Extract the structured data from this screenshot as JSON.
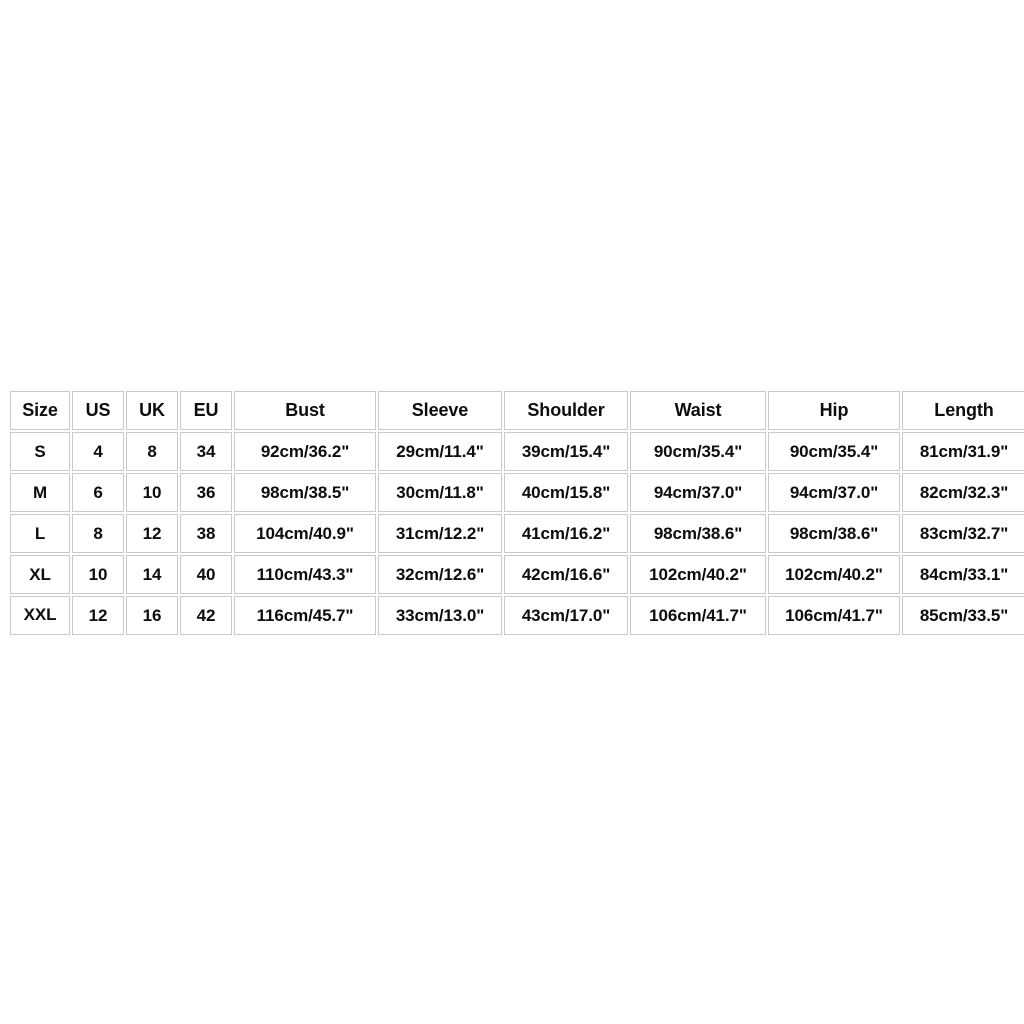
{
  "page": {
    "background_color": "#ffffff",
    "text_color": "#0d0d0d",
    "border_color": "#c9c9c9",
    "spellcheck_underline_color": "#e03a2f"
  },
  "chart_data": {
    "type": "table",
    "title": "",
    "columns": [
      "Size",
      "US",
      "UK",
      "EU",
      "Bust",
      "Sleeve",
      "Shoulder",
      "Waist",
      "Hip",
      "Length"
    ],
    "rows": [
      {
        "size": "S",
        "us": "4",
        "uk": "8",
        "eu": "34",
        "bust": "92cm/36.2\"",
        "sleeve": "29cm/11.4\"",
        "shoulder": "39cm/15.4\"",
        "waist": "90cm/35.4\"",
        "hip": "90cm/35.4\"",
        "length": "81cm/31.9\"",
        "misspelled": false
      },
      {
        "size": "M",
        "us": "6",
        "uk": "10",
        "eu": "36",
        "bust": "98cm/38.5\"",
        "sleeve": "30cm/11.8\"",
        "shoulder": "40cm/15.8\"",
        "waist": "94cm/37.0\"",
        "hip": "94cm/37.0\"",
        "length": "82cm/32.3\"",
        "misspelled": false
      },
      {
        "size": "L",
        "us": "8",
        "uk": "12",
        "eu": "38",
        "bust": "104cm/40.9\"",
        "sleeve": "31cm/12.2\"",
        "shoulder": "41cm/16.2\"",
        "waist": "98cm/38.6\"",
        "hip": "98cm/38.6\"",
        "length": "83cm/32.7\"",
        "misspelled": false
      },
      {
        "size": "XL",
        "us": "10",
        "uk": "14",
        "eu": "40",
        "bust": "110cm/43.3\"",
        "sleeve": "32cm/12.6\"",
        "shoulder": "42cm/16.6\"",
        "waist": "102cm/40.2\"",
        "hip": "102cm/40.2\"",
        "length": "84cm/33.1\"",
        "misspelled": false
      },
      {
        "size": "XXL",
        "us": "12",
        "uk": "16",
        "eu": "42",
        "bust": "116cm/45.7\"",
        "sleeve": "33cm/13.0\"",
        "shoulder": "43cm/17.0\"",
        "waist": "106cm/41.7\"",
        "hip": "106cm/41.7\"",
        "length": "85cm/33.5\"",
        "misspelled": true
      }
    ]
  }
}
